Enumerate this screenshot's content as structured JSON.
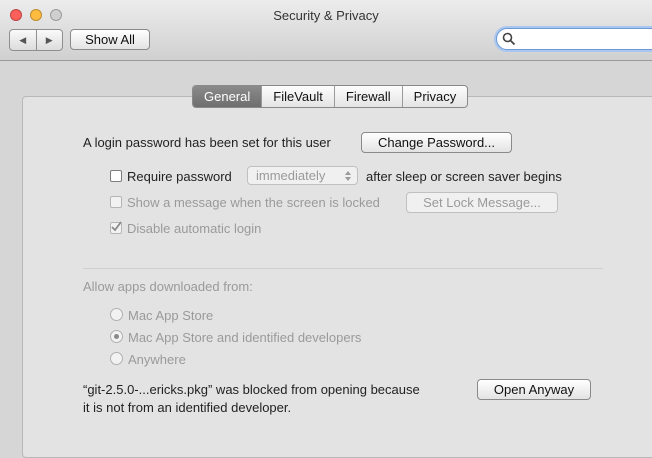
{
  "window": {
    "title": "Security & Privacy"
  },
  "toolbar": {
    "back_glyph": "◀",
    "forward_glyph": "▶",
    "show_all_label": "Show All",
    "search_placeholder": ""
  },
  "tabs": [
    {
      "label": "General",
      "active": true
    },
    {
      "label": "FileVault",
      "active": false
    },
    {
      "label": "Firewall",
      "active": false
    },
    {
      "label": "Privacy",
      "active": false
    }
  ],
  "general": {
    "login_password_text": "A login password has been set for this user",
    "change_password_label": "Change Password...",
    "require_password_label": "Require password",
    "require_password_select": "immediately",
    "after_sleep_text": "after sleep or screen saver begins",
    "show_message_label": "Show a message when the screen is locked",
    "set_lock_message_label": "Set Lock Message...",
    "disable_auto_login_label": "Disable automatic login",
    "allow_apps_heading": "Allow apps downloaded from:",
    "radio_options": [
      "Mac App Store",
      "Mac App Store and identified developers",
      "Anywhere"
    ],
    "selected_radio": "Mac App Store and identified developers",
    "blocked_line1": "“git-2.5.0-...ericks.pkg” was blocked from opening because",
    "blocked_line2": "it is not from an identified developer.",
    "open_anyway_label": "Open Anyway"
  },
  "colors": {
    "red": "#fc605b",
    "yellow": "#fdbc40",
    "green_disabled": "#cfcfcf",
    "active_tab": "#7a7a7a"
  }
}
